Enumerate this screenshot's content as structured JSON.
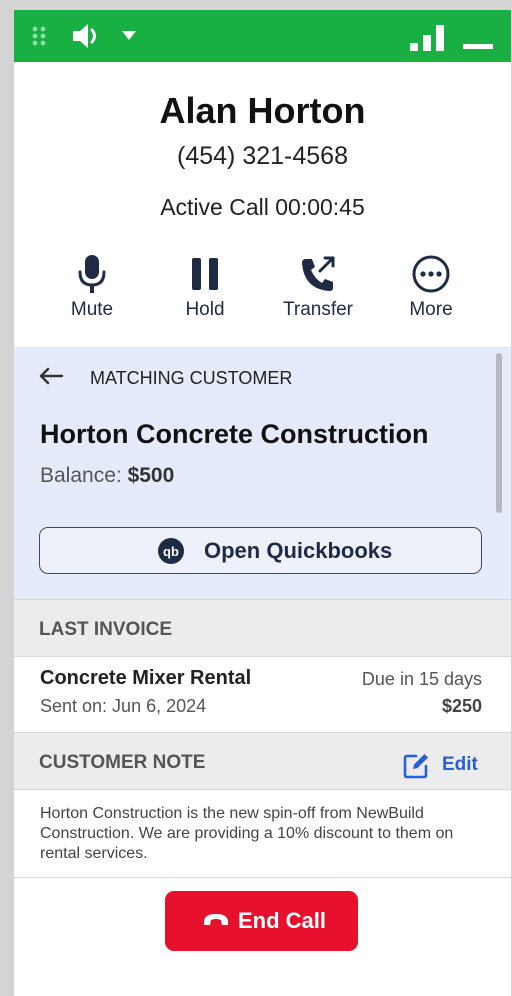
{
  "window": {
    "titlebar_icons": [
      "drag-handle-icon",
      "speaker-icon",
      "chevron-down-icon",
      "signal-icon",
      "minimize-icon"
    ],
    "accent_color": "#18b043"
  },
  "caller": {
    "name": "Alan Horton",
    "phone": "(454) 321-4568",
    "status": "Active Call 00:00:45"
  },
  "actions": [
    {
      "label": "Mute",
      "icon": "microphone-icon"
    },
    {
      "label": "Hold",
      "icon": "pause-icon"
    },
    {
      "label": "Transfer",
      "icon": "phone-transfer-icon"
    },
    {
      "label": "More",
      "icon": "more-icon"
    }
  ],
  "matching": {
    "caption": "MATCHING CUSTOMER",
    "company": "Horton Concrete Construction",
    "balance_label": "Balance:",
    "balance_value": "$500",
    "button_label": "Open Quickbooks",
    "button_icon": "quickbooks-icon",
    "background_color": "#e6ebfb"
  },
  "last_invoice": {
    "header": "LAST INVOICE",
    "item": "Concrete Mixer Rental",
    "sent": "Sent on: Jun 6, 2024",
    "due": "Due in 15 days",
    "amount": "$250"
  },
  "customer_note": {
    "header": "CUSTOMER NOTE",
    "edit_label": "Edit",
    "text": "Horton Construction is the new spin-off from NewBuild Construction. We are providing a 10% discount to them on rental services."
  },
  "end_call": {
    "label": "End Call",
    "color": "#e8112d"
  }
}
